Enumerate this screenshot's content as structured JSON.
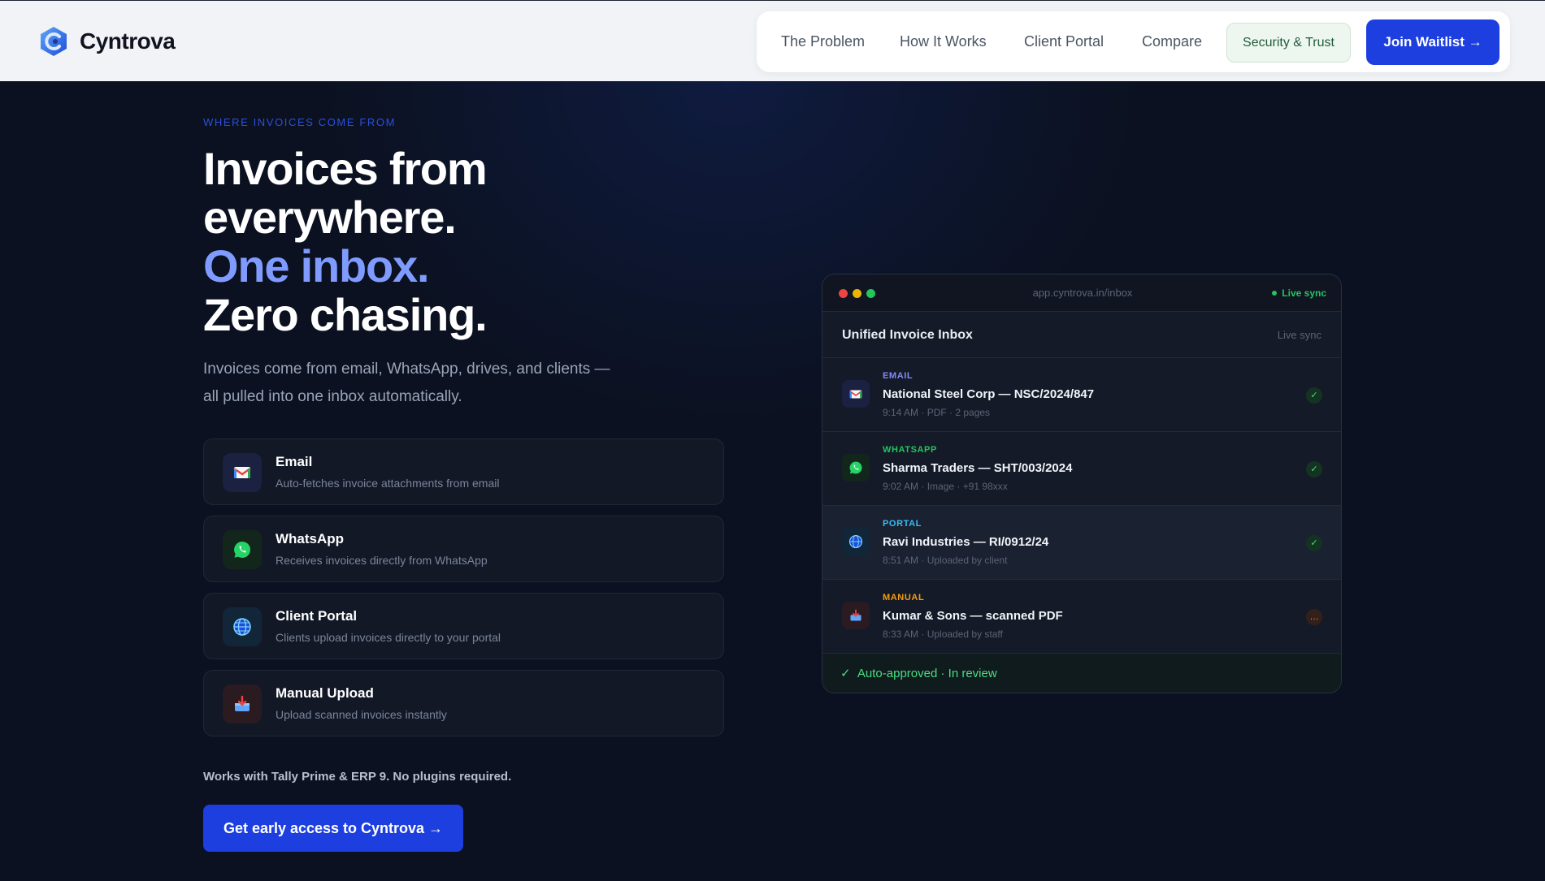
{
  "brand": {
    "name": "Cyntrova"
  },
  "nav": {
    "links": [
      "The Problem",
      "How It Works",
      "Client Portal",
      "Compare"
    ],
    "security_label": "Security & Trust",
    "join_label": "Join Waitlist →"
  },
  "hero": {
    "eyebrow": "WHERE INVOICES COME FROM",
    "headline_line1": "Invoices from",
    "headline_line2": "everywhere.",
    "headline_line3": "One inbox.",
    "headline_line4": "Zero chasing.",
    "subtitle": "Invoices come from email, WhatsApp, drives, and clients — all pulled into one inbox automatically.",
    "sources": [
      {
        "title": "Email",
        "description": "Auto-fetches invoice attachments from email",
        "icon": "gmail-icon"
      },
      {
        "title": "WhatsApp",
        "description": "Receives invoices directly from WhatsApp",
        "icon": "whatsapp-icon"
      },
      {
        "title": "Client Portal",
        "description": "Clients upload invoices directly to your portal",
        "icon": "globe-icon"
      },
      {
        "title": "Manual Upload",
        "description": "Upload scanned invoices instantly",
        "icon": "inbox-tray-icon"
      }
    ],
    "works_with": "Works with Tally Prime & ERP 9. No plugins required.",
    "cta_label": "Get early access to Cyntrova →"
  },
  "inbox_window": {
    "url": "app.cyntrova.in/inbox",
    "live_sync_badge": "Live sync",
    "panel_title": "Unified Invoice Inbox",
    "panel_sync": "Live sync",
    "rows": [
      {
        "tag": "EMAIL",
        "title": "National Steel Corp — NSC/2024/847",
        "meta": "9:14 AM · PDF · 2 pages",
        "status": "✓"
      },
      {
        "tag": "WHATSAPP",
        "title": "Sharma Traders — SHT/003/2024",
        "meta": "9:02 AM · Image · +91 98xxx",
        "status": "✓"
      },
      {
        "tag": "PORTAL",
        "title": "Ravi Industries — RI/0912/24",
        "meta": "8:51 AM · Uploaded by client",
        "status": "✓"
      },
      {
        "tag": "MANUAL",
        "title": "Kumar & Sons — scanned PDF",
        "meta": "8:33 AM · Uploaded by staff",
        "status": "…"
      }
    ],
    "footer_check": "✓",
    "footer_status": "Auto-approved · In review"
  },
  "colors": {
    "accent": "#1d3fe0",
    "headline_accent": "#7f9bff",
    "email_tag": "#818cf8",
    "whatsapp_tag": "#22c55e",
    "portal_tag": "#38bdf8",
    "manual_tag": "#f59e0b"
  }
}
